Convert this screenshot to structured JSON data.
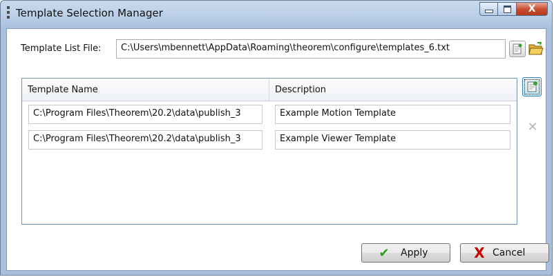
{
  "window": {
    "title": "Template Selection Manager",
    "controls": {
      "minimize": "minimize",
      "maximize": "maximize",
      "close": "X"
    }
  },
  "list_file": {
    "label": "Template List File:",
    "value": "C:\\Users\\mbennett\\AppData\\Roaming\\theorem\\configure\\templates_6.txt",
    "new_icon": "new-file-icon",
    "open_icon": "open-folder-icon"
  },
  "table": {
    "columns": [
      "Template Name",
      "Description"
    ],
    "rows": [
      {
        "name": "C:\\Program Files\\Theorem\\20.2\\data\\publish_3",
        "description": "Example Motion Template"
      },
      {
        "name": "C:\\Program Files\\Theorem\\20.2\\data\\publish_3",
        "description": "Example Viewer Template"
      }
    ],
    "add_icon": "add-row-icon",
    "delete_icon": "delete-row-icon",
    "delete_glyph": "✕"
  },
  "buttons": {
    "apply": "Apply",
    "cancel": "Cancel",
    "apply_glyph": "✔",
    "cancel_glyph": "X"
  },
  "colors": {
    "frame": "#bcd0e8",
    "close_button": "#c74a2f",
    "grid_border": "#6d90bd",
    "apply_check": "#2f9e1f",
    "cancel_x": "#c80000"
  }
}
